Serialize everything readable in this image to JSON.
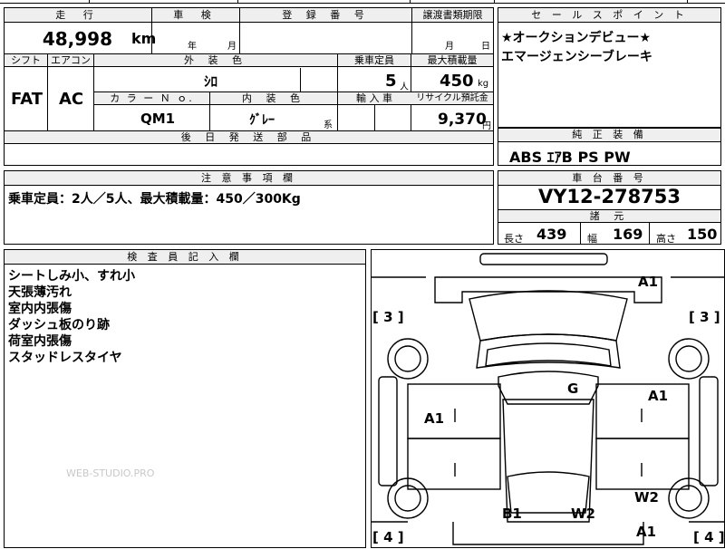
{
  "top_strip": {
    "fragment_1": "/",
    "fragment_2": "ｇ"
  },
  "info": {
    "mileage_label": "走 行",
    "mileage_value": "48,998",
    "mileage_unit": "km",
    "inspection_label": "車 検",
    "inspection_year": "年",
    "inspection_month": "月",
    "registration_label": "登 録 番 号",
    "registration_value": "",
    "transfer_label": "譲渡書類期限",
    "transfer_month": "月",
    "transfer_day": "日",
    "shift_label": "シフト",
    "shift_value": "FAT",
    "ac_label": "エアコン",
    "ac_value": "AC",
    "exterior_label": "外 装 色",
    "exterior_value": "ｼﾛ",
    "capacity_label": "乗車定員",
    "capacity_value": "5",
    "capacity_unit": "人",
    "maxload_label": "最大積載量",
    "maxload_value": "450",
    "maxload_unit": "kg",
    "color_no_label": "カ ラ ー Ｎ ｏ.",
    "color_no_value": "QM1",
    "interior_label": "内 装 色",
    "interior_value": "ｸﾞﾚｰ",
    "interior_suffix": "系",
    "import_label": "輸 入 車",
    "recycle_label": "リサイクル預託金",
    "recycle_value": "9,370",
    "recycle_unit": "円",
    "later_parts_label": "後 日 発 送 部 品"
  },
  "sales_points": {
    "title": "セ ー ル ス ポ イ ン ト",
    "line1": "★オークションデビュー★",
    "line2": "エマージェンシーブレーキ"
  },
  "equipment": {
    "title": "純 正 装 備",
    "value": "ABS ｴｱB PS PW"
  },
  "notes": {
    "title": "注 意 事 項 欄",
    "text": "乗車定員：2人／5人、最大積載量：450／300Kg"
  },
  "chassis": {
    "title": "車 台 番 号",
    "value": "VY12-278753"
  },
  "specs": {
    "title": "諸 元",
    "length_label": "長さ",
    "length_value": "439",
    "width_label": "幅",
    "width_value": "169",
    "height_label": "高さ",
    "height_value": "150"
  },
  "inspector": {
    "title": "検 査 員 記 入 欄",
    "lines": [
      "シートしみ小、すれ小",
      "天張薄汚れ",
      "室内内張傷",
      "ダッシュ板のり跡",
      "荷室内張傷",
      "スタッドレスタイヤ"
    ]
  },
  "watermark": "WEB-STUDIO.PRO",
  "diagram": {
    "bracket_tl": "[ 3 ]",
    "bracket_tr": "[ 3 ]",
    "bracket_bl": "[ 4 ]",
    "bracket_br": "[ 4 ]",
    "marks": {
      "top_right": "A1",
      "roof": "G",
      "right_front_door": "A1",
      "left_side": "A1",
      "right_rear": "W2",
      "rear_left": "B1",
      "rear_right": "W2",
      "bottom_right": "A1"
    }
  }
}
